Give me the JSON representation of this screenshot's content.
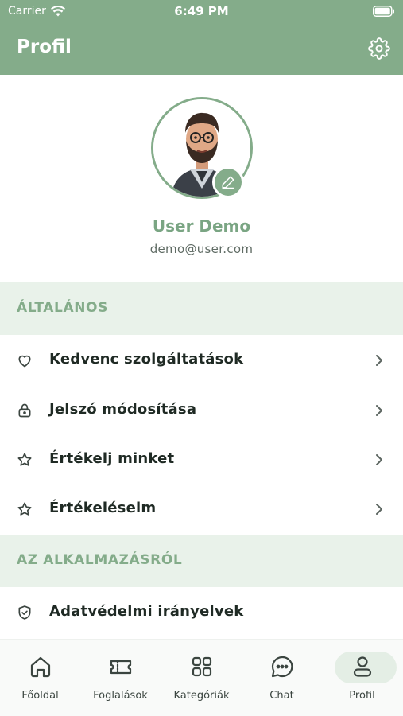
{
  "status": {
    "carrier": "Carrier",
    "time": "6:49 PM"
  },
  "header": {
    "title": "Profil"
  },
  "profile": {
    "name": "User Demo",
    "email": "demo@user.com"
  },
  "sections": {
    "general": {
      "title": "ÁLTALÁNOS",
      "items": [
        {
          "label": "Kedvenc szolgáltatások",
          "icon": "heart-icon"
        },
        {
          "label": "Jelszó módosítása",
          "icon": "lock-icon"
        },
        {
          "label": "Értékelj minket",
          "icon": "star-icon"
        },
        {
          "label": "Értékeléseim",
          "icon": "star-icon"
        }
      ]
    },
    "about": {
      "title": "AZ ALKALMAZÁSRÓL",
      "items": [
        {
          "label": "Adatvédelmi irányelvek",
          "icon": "shield-icon"
        }
      ]
    }
  },
  "tabs": [
    {
      "label": "Főoldal",
      "icon": "home-icon"
    },
    {
      "label": "Foglalások",
      "icon": "ticket-icon"
    },
    {
      "label": "Kategóriák",
      "icon": "grid-icon"
    },
    {
      "label": "Chat",
      "icon": "chat-icon"
    },
    {
      "label": "Profil",
      "icon": "user-icon",
      "active": true
    }
  ],
  "colors": {
    "accent": "#84ac8a",
    "accent_light": "#e9f2ea",
    "name": "#7aa583"
  }
}
